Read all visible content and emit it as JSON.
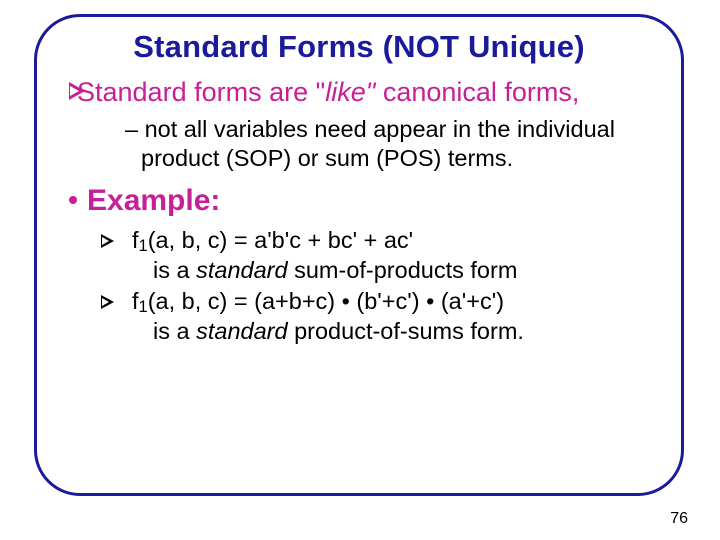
{
  "title": "Standard Forms (NOT Unique)",
  "bullet1_prefix": "Standard forms are \"",
  "bullet1_italic": "like\"",
  "bullet1_suffix": " canonical forms,",
  "dash_prefix": "– ",
  "dash_text": "not all variables need appear in the individual product (SOP) or sum (POS) terms.",
  "example_label": "Example:",
  "sub1_func": "f",
  "sub1_sub": "1",
  "sub1_args": "(a, b, c) = a'b'c + bc' + ac'",
  "sub1_line2a": "is a ",
  "sub1_line2b": "standard",
  "sub1_line2c": " sum-of-products form",
  "sub2_args": "(a, b, c) = (a+b+c) • (b'+c') • (a'+c')",
  "sub2_line2c": " product-of-sums form.",
  "page": "76"
}
